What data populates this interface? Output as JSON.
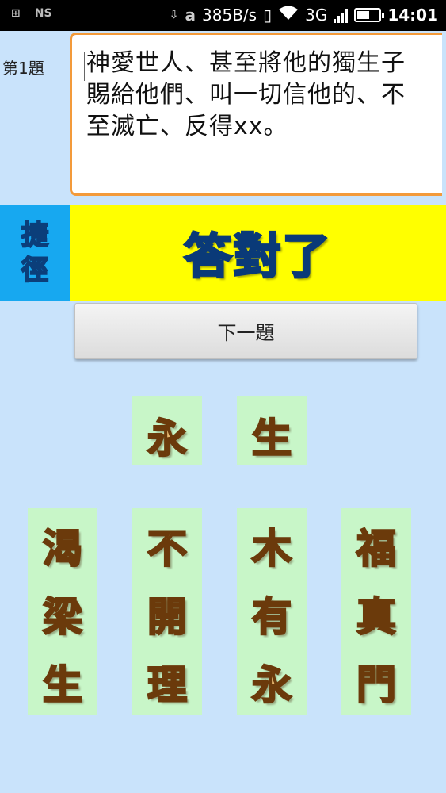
{
  "status_bar": {
    "notification_ns": "NS",
    "notification_amazon": "a",
    "net_speed": "385B/s",
    "network_type": "3G",
    "time": "14:01",
    "battery_level": 0.55
  },
  "question": {
    "label": "第1題",
    "text": "神愛世人、甚至將他的獨生子賜給他們、叫一切信他的、不至滅亡、反得xx。"
  },
  "shortcut": {
    "line1": "捷",
    "line2": "徑"
  },
  "result": {
    "message": "答對了"
  },
  "next_button": {
    "label": "下一題"
  },
  "answer_tiles": [
    "永",
    "生"
  ],
  "choice_tiles": [
    [
      "渴",
      "梁",
      "生"
    ],
    [
      "不",
      "開",
      "理"
    ],
    [
      "木",
      "有",
      "永"
    ],
    [
      "福",
      "真",
      "門"
    ]
  ],
  "colors": {
    "background": "#c9e3fb",
    "question_border": "#f39a3a",
    "result_background": "#ffff00",
    "shortcut_background": "#17a8f0",
    "tile_background": "#c8f6c8"
  }
}
